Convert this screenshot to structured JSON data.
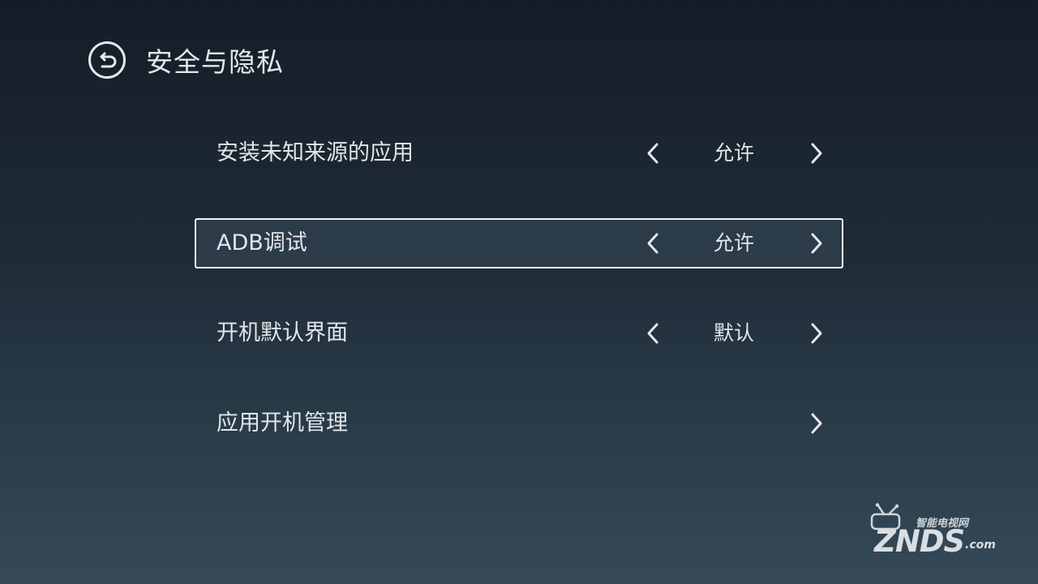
{
  "header": {
    "title": "安全与隐私",
    "back_icon": "back-icon"
  },
  "settings": [
    {
      "label": "安装未知来源的应用",
      "value": "允许",
      "has_arrows": true,
      "focused": false
    },
    {
      "label": "ADB调试",
      "value": "允许",
      "has_arrows": true,
      "focused": true
    },
    {
      "label": "开机默认界面",
      "value": "默认",
      "has_arrows": true,
      "focused": false
    },
    {
      "label": "应用开机管理",
      "value": "",
      "has_arrows": false,
      "focused": false
    }
  ],
  "watermark": {
    "tagline": "智能电视网",
    "brand": "ZNDS",
    "suffix": ".com"
  },
  "colors": {
    "background_top": "#141d27",
    "background_bottom": "#354958",
    "text": "#e3e6e9",
    "focus_border": "#f4f6f8"
  }
}
